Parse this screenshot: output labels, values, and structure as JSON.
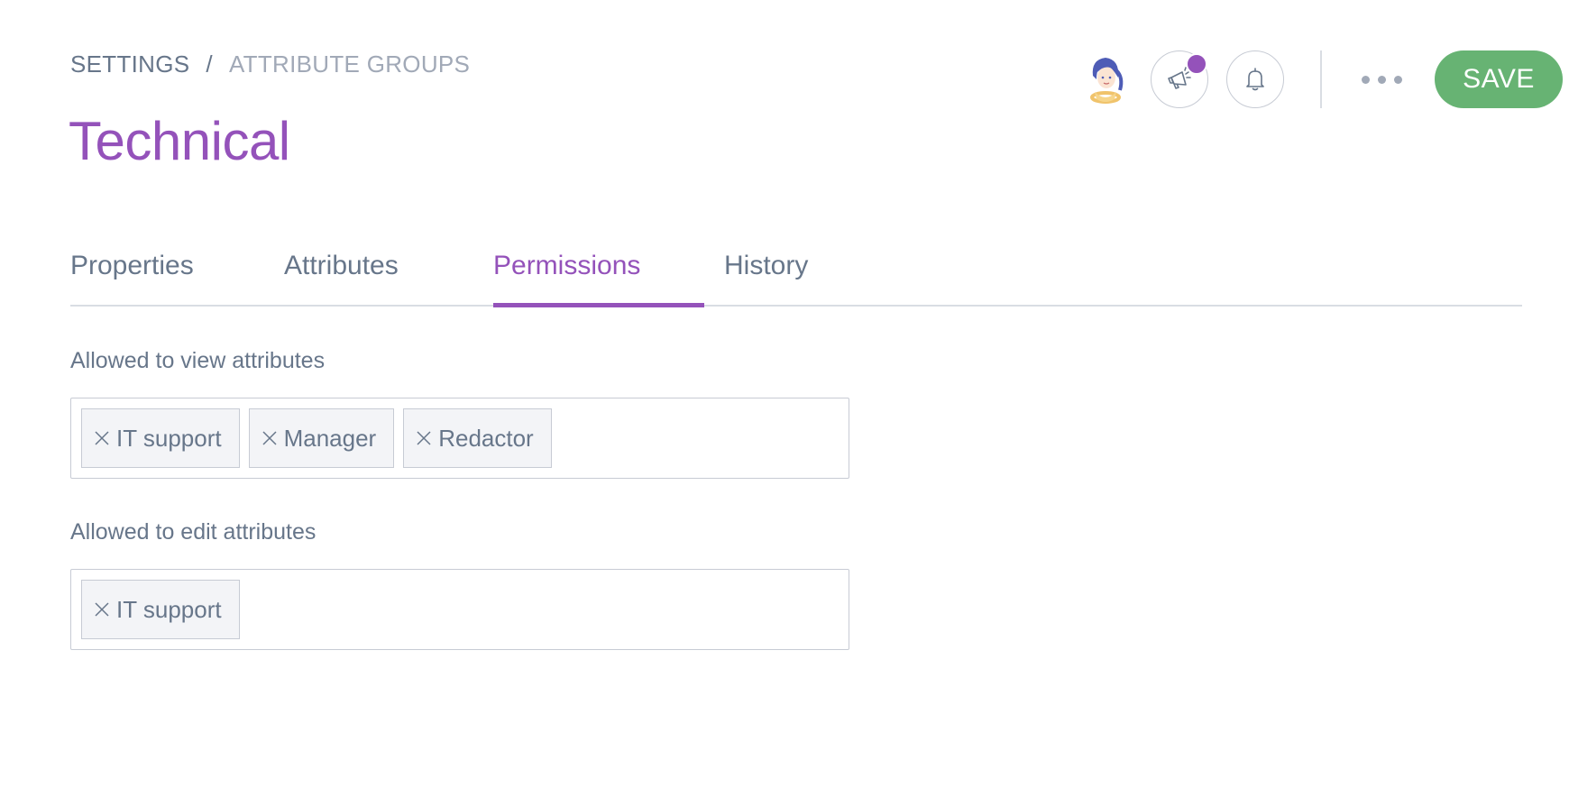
{
  "breadcrumb": {
    "root": "SETTINGS",
    "separator": "/",
    "current": "ATTRIBUTE GROUPS"
  },
  "page_title": "Technical",
  "header": {
    "avatar_icon": "user-avatar-illustration",
    "announcements_icon": "megaphone-icon",
    "notifications_icon": "bell-icon",
    "more_icon": "ellipsis-icon",
    "save_label": "SAVE"
  },
  "tabs": [
    {
      "label": "Properties",
      "active": false
    },
    {
      "label": "Attributes",
      "active": false
    },
    {
      "label": "Permissions",
      "active": true
    },
    {
      "label": "History",
      "active": false
    }
  ],
  "permissions": {
    "view": {
      "label": "Allowed to view attributes",
      "tags": [
        "IT support",
        "Manager",
        "Redactor"
      ]
    },
    "edit": {
      "label": "Allowed to edit attributes",
      "tags": [
        "IT support"
      ]
    }
  },
  "colors": {
    "accent": "#9452ba",
    "save": "#67b373",
    "text": "#67768a",
    "muted": "#a1a9b7",
    "border": "#c7cbd4"
  }
}
